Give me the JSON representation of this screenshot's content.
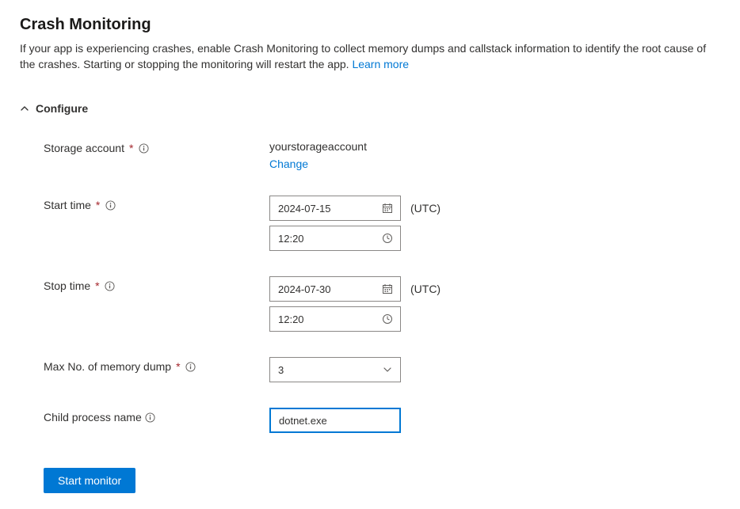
{
  "header": {
    "title": "Crash Monitoring",
    "description_prefix": "If your app is experiencing crashes, enable Crash Monitoring to collect memory dumps and callstack information to identify the root cause of the crashes. Starting or stopping the monitoring will restart the app. ",
    "learn_more": "Learn more"
  },
  "section": {
    "title": "Configure"
  },
  "fields": {
    "storage": {
      "label": "Storage account",
      "value": "yourstorageaccount",
      "change": "Change"
    },
    "start": {
      "label": "Start time",
      "date": "2024-07-15",
      "time": "12:20",
      "tz": "(UTC)"
    },
    "stop": {
      "label": "Stop time",
      "date": "2024-07-30",
      "time": "12:20",
      "tz": "(UTC)"
    },
    "maxdump": {
      "label": "Max No. of memory dump",
      "value": "3"
    },
    "child": {
      "label": "Child process name",
      "value": "dotnet.exe"
    }
  },
  "actions": {
    "start_monitor": "Start monitor"
  }
}
